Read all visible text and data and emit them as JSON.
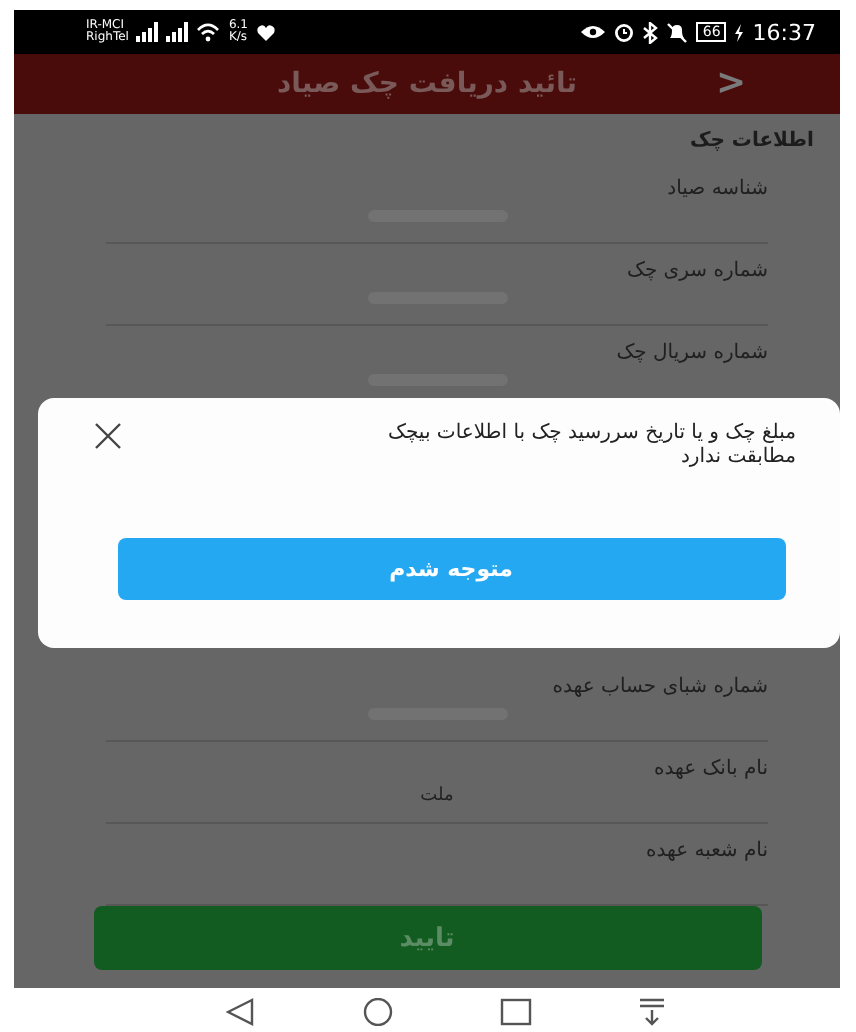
{
  "status_bar": {
    "carrier_top": "IR-MCI",
    "carrier_bottom": "RighTel",
    "speed_value": "6.1",
    "speed_unit": "K/s",
    "battery": "66",
    "time": "16:37"
  },
  "header": {
    "title": "تائید دریافت چک صیاد",
    "back": ">"
  },
  "section_title": "اطلاعات چک",
  "fields_top": [
    {
      "label": "شناسه صیاد",
      "redacted": true
    },
    {
      "label": "شماره سری چک",
      "redacted": true
    },
    {
      "label": "شماره سریال چک",
      "redacted": true
    }
  ],
  "fields_bottom": [
    {
      "label": "شماره شبای حساب عهده",
      "redacted": true
    },
    {
      "label": "نام بانک عهده",
      "redacted": false,
      "value": "ملت"
    },
    {
      "label": "نام شعبه عهده",
      "redacted": false
    }
  ],
  "confirm_button": "تایید",
  "dialog": {
    "message": "مبلغ چک و یا تاریخ سررسید چک با اطلاعات بیچک مطابقت ندارد",
    "button": "متوجه شدم"
  }
}
